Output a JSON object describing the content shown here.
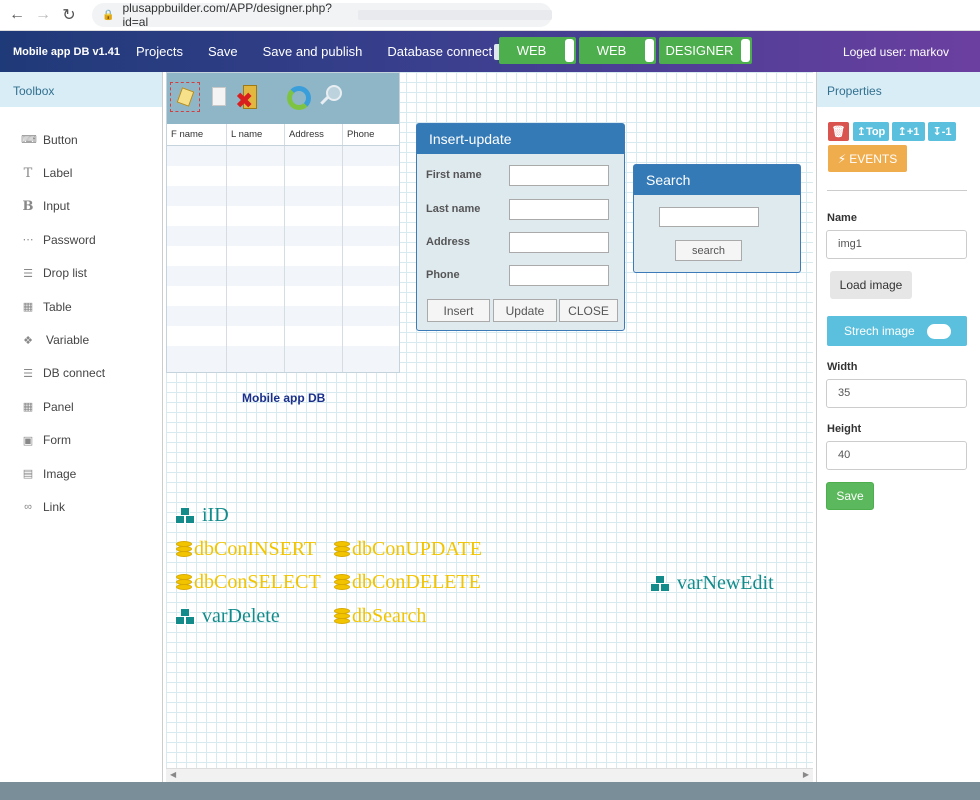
{
  "browser": {
    "url": "plusappbuilder.com/APP/designer.php?id=al"
  },
  "header": {
    "app_title": "Mobile app DB v1.41",
    "menu": [
      "Projects",
      "Save",
      "Save and publish",
      "Database connect"
    ],
    "modes": [
      "WEB",
      "WEB",
      "DESIGNER"
    ],
    "user": "Loged user: markov"
  },
  "toolbox": {
    "title": "Toolbox",
    "items": [
      {
        "label": "Button",
        "icon": "button-icon"
      },
      {
        "label": "Label",
        "icon": "text-icon"
      },
      {
        "label": "Input",
        "icon": "bold-b-icon"
      },
      {
        "label": "Password",
        "icon": "dots-icon"
      },
      {
        "label": "Drop list",
        "icon": "list-icon"
      },
      {
        "label": "Table",
        "icon": "table-icon"
      },
      {
        "label": "Variable",
        "icon": "cubes-icon"
      },
      {
        "label": "DB connect",
        "icon": "database-icon"
      },
      {
        "label": "Panel",
        "icon": "panel-icon"
      },
      {
        "label": "Form",
        "icon": "window-icon"
      },
      {
        "label": "Image",
        "icon": "image-icon"
      },
      {
        "label": "Link",
        "icon": "link-icon"
      }
    ]
  },
  "canvas": {
    "grid": {
      "columns": [
        "F name",
        "L name",
        "Address",
        "Phone"
      ]
    },
    "insert_panel": {
      "title": "Insert-update",
      "fields": [
        "First name",
        "Last name",
        "Address",
        "Phone"
      ],
      "buttons": [
        "Insert",
        "Update",
        "CLOSE"
      ]
    },
    "search_panel": {
      "title": "Search",
      "button": "search"
    },
    "label_text": "Mobile app DB",
    "objects": {
      "iid": "iID",
      "ins": "dbConINSERT",
      "upd": "dbConUPDATE",
      "sel": "dbConSELECT",
      "del": "dbConDELETE",
      "newedit": "varNewEdit",
      "vdel": "varDelete",
      "srch": "dbSearch"
    }
  },
  "properties": {
    "title": "Properties",
    "top_buttons": [
      "Top",
      "+1",
      "-1"
    ],
    "events": "EVENTS",
    "name_label": "Name",
    "name_value": "img1",
    "load_image": "Load image",
    "strech": "Strech image",
    "width_label": "Width",
    "width_value": "35",
    "height_label": "Height",
    "height_value": "40",
    "save": "Save"
  }
}
